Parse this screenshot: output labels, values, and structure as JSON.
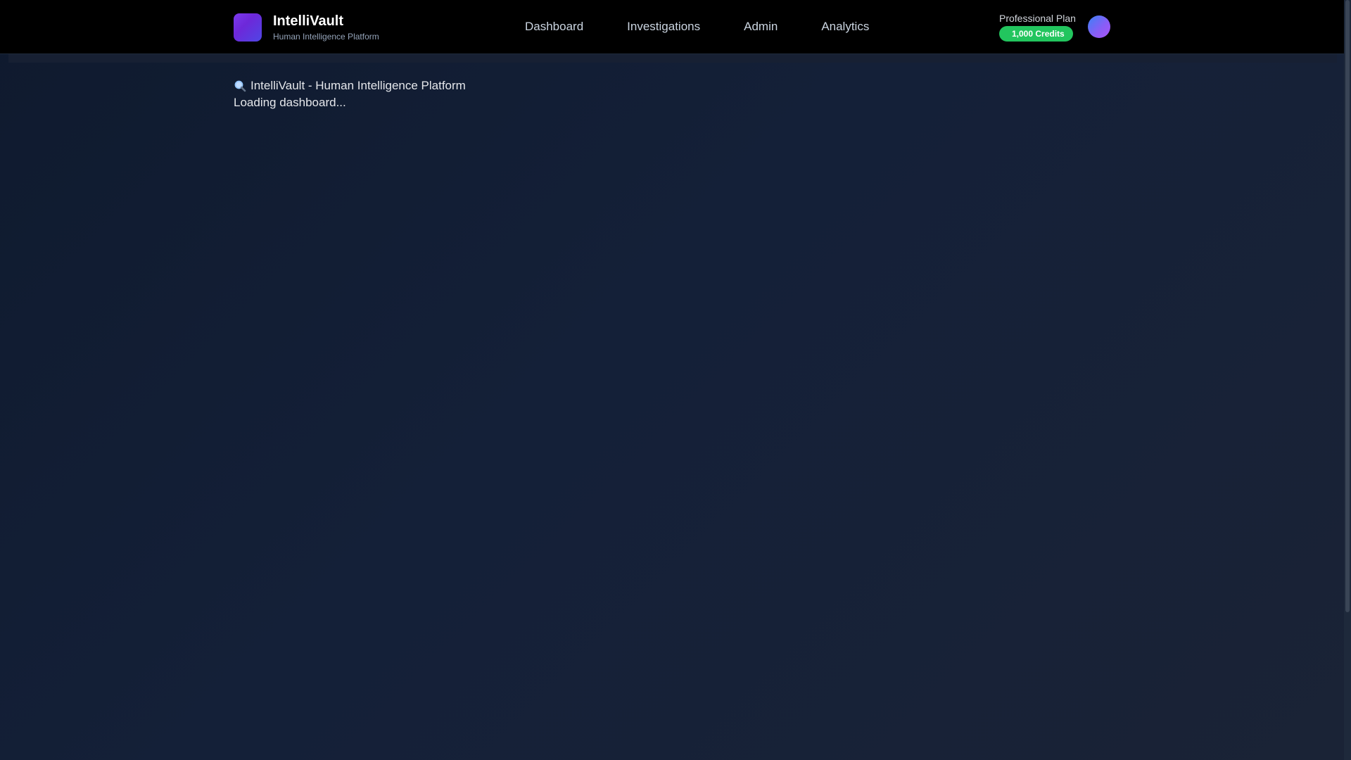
{
  "header": {
    "brand_name": "IntelliVault",
    "brand_tagline": "Human Intelligence Platform",
    "nav": [
      {
        "label": "Dashboard"
      },
      {
        "label": "Investigations"
      },
      {
        "label": "Admin"
      },
      {
        "label": "Analytics"
      }
    ],
    "plan_name": "Professional Plan",
    "credits": "1,000 Credits"
  },
  "main": {
    "title": "IntelliVault - Human Intelligence Platform",
    "status": "Loading dashboard..."
  },
  "colors": {
    "background": "#142038",
    "header": "#000000",
    "brand_accent": "#7c3aed",
    "credits_badge": "#22c55e",
    "avatar": "#6d6cf6"
  },
  "icons": {
    "logo": "brand-logo-icon",
    "loading": "search-icon"
  }
}
